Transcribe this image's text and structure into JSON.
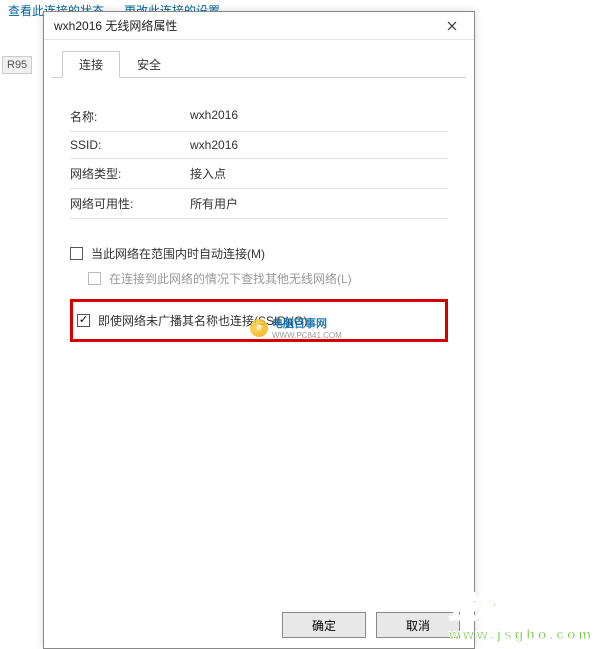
{
  "background": {
    "link1": "查看此连接的状态",
    "link2": "更改此连接的设置",
    "label": "R95"
  },
  "dialog": {
    "title": "wxh2016 无线网络属性",
    "tabs": {
      "connect": "连接",
      "security": "安全"
    },
    "properties": {
      "name_label": "名称:",
      "name_value": "wxh2016",
      "ssid_label": "SSID:",
      "ssid_value": "wxh2016",
      "type_label": "网络类型:",
      "type_value": "接入点",
      "avail_label": "网络可用性:",
      "avail_value": "所有用户"
    },
    "checkboxes": {
      "auto_connect": "当此网络在范围内时自动连接(M)",
      "find_other": "在连接到此网络的情况下查找其他无线网络(L)",
      "connect_hidden": "即使网络未广播其名称也连接(SSID)(O)"
    },
    "buttons": {
      "ok": "确定",
      "cancel": "取消"
    }
  },
  "watermarks": {
    "pcbay_cn": "电脑百事网",
    "pcbay_en": "WWW.PC841.COM",
    "jsgho_cn": "技术员联盟",
    "jsgho_en": "www.jsgho.com"
  }
}
